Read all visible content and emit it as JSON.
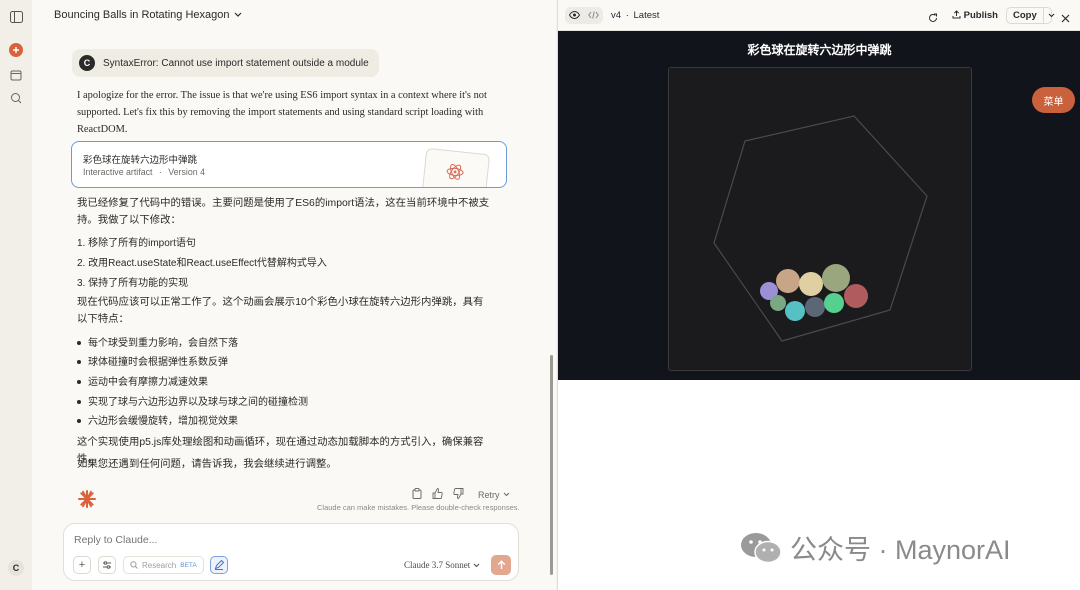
{
  "sidebar": {
    "user_initial": "C",
    "icons": [
      "sidebar-toggle-icon",
      "new-chat-icon",
      "chats-icon",
      "projects-icon"
    ]
  },
  "header": {
    "title": "Bouncing Balls in Rotating Hexagon"
  },
  "chat": {
    "user_message": {
      "avatar_initial": "C",
      "text": "SyntaxError: Cannot use import statement outside a module"
    },
    "reply_intro": "I apologize for the error. The issue is that we're using ES6 import syntax in a context where it's not supported. Let's fix this by removing the import statements and using standard script loading with ReactDOM.",
    "artifact": {
      "title": "彩色球在旋转六边形中弹跳",
      "type": "Interactive artifact",
      "sep": "·",
      "version": "Version 4"
    },
    "fix_summary": "我已经修复了代码中的错误。主要问题是使用了ES6的import语法，这在当前环境中不被支持。我做了以下修改：",
    "fixes": [
      "移除了所有的import语句",
      "改用React.useState和React.useEffect代替解构式导入",
      "保持了所有功能的实现"
    ],
    "features_intro": "现在代码应该可以正常工作了。这个动画会展示10个彩色小球在旋转六边形内弹跳，具有以下特点：",
    "features": [
      "每个球受到重力影响，会自然下落",
      "球体碰撞时会根据弹性系数反弹",
      "运动中会有摩擦力减速效果",
      "实现了球与六边形边界以及球与球之间的碰撞检测",
      "六边形会缓慢旋转，增加视觉效果"
    ],
    "implementation": "这个实现使用p5.js库处理绘图和动画循环，现在通过动态加载脚本的方式引入，确保兼容性。",
    "closing": "如果您还遇到任何问题，请告诉我，我会继续进行调整。",
    "retry_label": "Retry",
    "disclaimer": "Claude can make mistakes. Please double-check responses."
  },
  "composer": {
    "placeholder": "Reply to Claude...",
    "research_label": "Research",
    "beta_label": "BETA",
    "model": "Claude 3.7 Sonnet"
  },
  "preview": {
    "version_label": "v4",
    "version_sep": "·",
    "version_status": "Latest",
    "publish_label": "Publish",
    "copy_label": "Copy",
    "title": "彩色球在旋转六边形中弹跳",
    "menu_label": "菜单",
    "balls": [
      {
        "color": "#9b8fd6"
      },
      {
        "color": "#c9a587"
      },
      {
        "color": "#e0cfa2"
      },
      {
        "color": "#9aa67e"
      },
      {
        "color": "#b05b5e"
      },
      {
        "color": "#7aa882"
      },
      {
        "color": "#56c1c4"
      },
      {
        "color": "#5b6775"
      },
      {
        "color": "#55d08f"
      }
    ]
  },
  "watermark": {
    "text": "公众号 · MaynorAI"
  },
  "colors": {
    "accent": "#c8613c",
    "stage_bg": "#12141c",
    "artifact_border": "#6a9bd8"
  }
}
